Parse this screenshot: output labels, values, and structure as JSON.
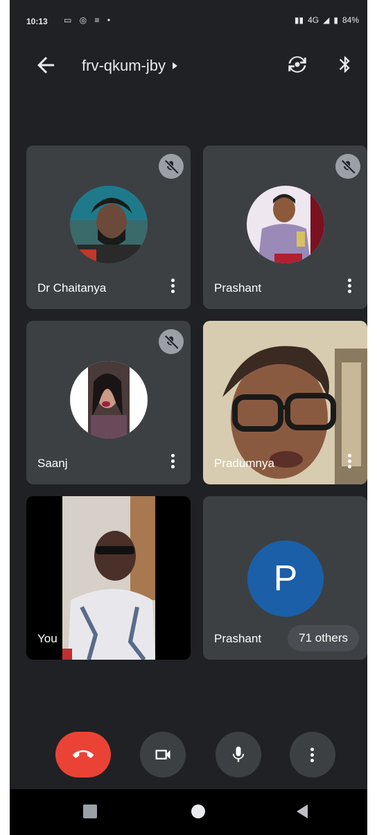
{
  "status_bar": {
    "time": "10:13",
    "network": "4G",
    "battery": "84%"
  },
  "header": {
    "meeting_code": "frv-qkum-jby",
    "back_icon": "arrow-left-icon",
    "switch_camera_icon": "switch-camera-icon",
    "audio_output_icon": "bluetooth-icon"
  },
  "tiles": [
    {
      "name": "Dr Chaitanya",
      "muted": true,
      "type": "avatar"
    },
    {
      "name": "Prashant",
      "muted": true,
      "type": "avatar"
    },
    {
      "name": "Saanj",
      "muted": true,
      "type": "avatar"
    },
    {
      "name": "Pradumnya",
      "muted": false,
      "type": "video"
    },
    {
      "name": "You",
      "muted": false,
      "type": "video"
    },
    {
      "name": "Prashant",
      "initial": "P",
      "others": "71 others",
      "type": "letter"
    }
  ],
  "controls": {
    "end_call_icon": "phone-hangup-icon",
    "camera_icon": "video-camera-icon",
    "mic_icon": "microphone-icon",
    "more_icon": "more-vert-icon"
  },
  "colors": {
    "background": "#202124",
    "tile": "#3c4043",
    "end_call": "#ea4335",
    "letter_avatar": "#1a5fa8"
  }
}
